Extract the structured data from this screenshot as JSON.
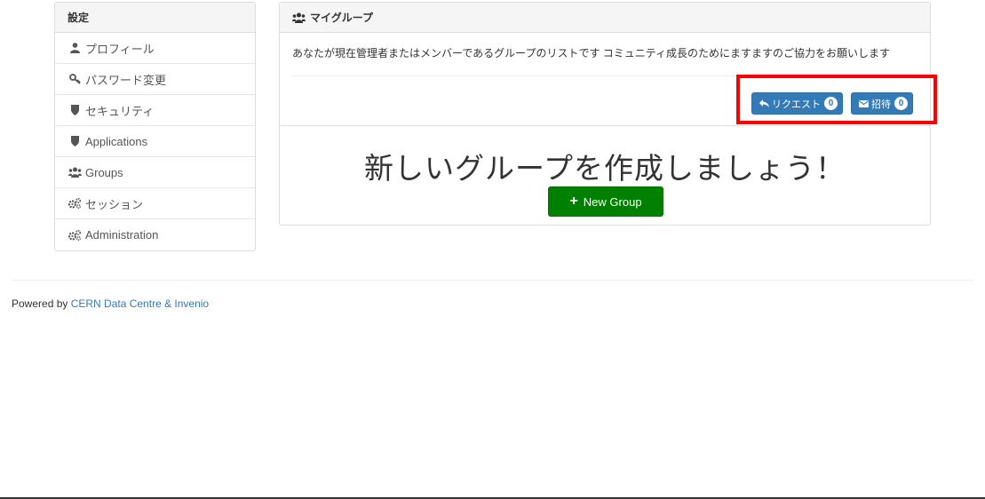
{
  "sidebar": {
    "heading": "設定",
    "items": [
      {
        "label": "プロフィール",
        "icon": "user-icon"
      },
      {
        "label": "パスワード変更",
        "icon": "key-icon"
      },
      {
        "label": "セキュリティ",
        "icon": "shield-icon"
      },
      {
        "label": "Applications",
        "icon": "shield-icon"
      },
      {
        "label": "Groups",
        "icon": "users-icon"
      },
      {
        "label": "セッション",
        "icon": "cogs-icon"
      },
      {
        "label": "Administration",
        "icon": "cogs-icon"
      }
    ]
  },
  "panel": {
    "title": "マイグループ",
    "description": "あなたが現在管理者またはメンバーであるグループのリストです コミュニティ成長のためにますますのご協力をお願いします",
    "requests_button": {
      "label": "リクエスト",
      "count": "0"
    },
    "invitations_button": {
      "label": "招待",
      "count": "0"
    },
    "cta_title": "新しいグループを作成しましょう！",
    "new_group_button": "New Group"
  },
  "footer": {
    "prefix": "Powered by ",
    "link": "CERN Data Centre & Invenio"
  },
  "colors": {
    "primary": "#337ab7",
    "success": "#008000",
    "highlight": "#ff0000"
  }
}
